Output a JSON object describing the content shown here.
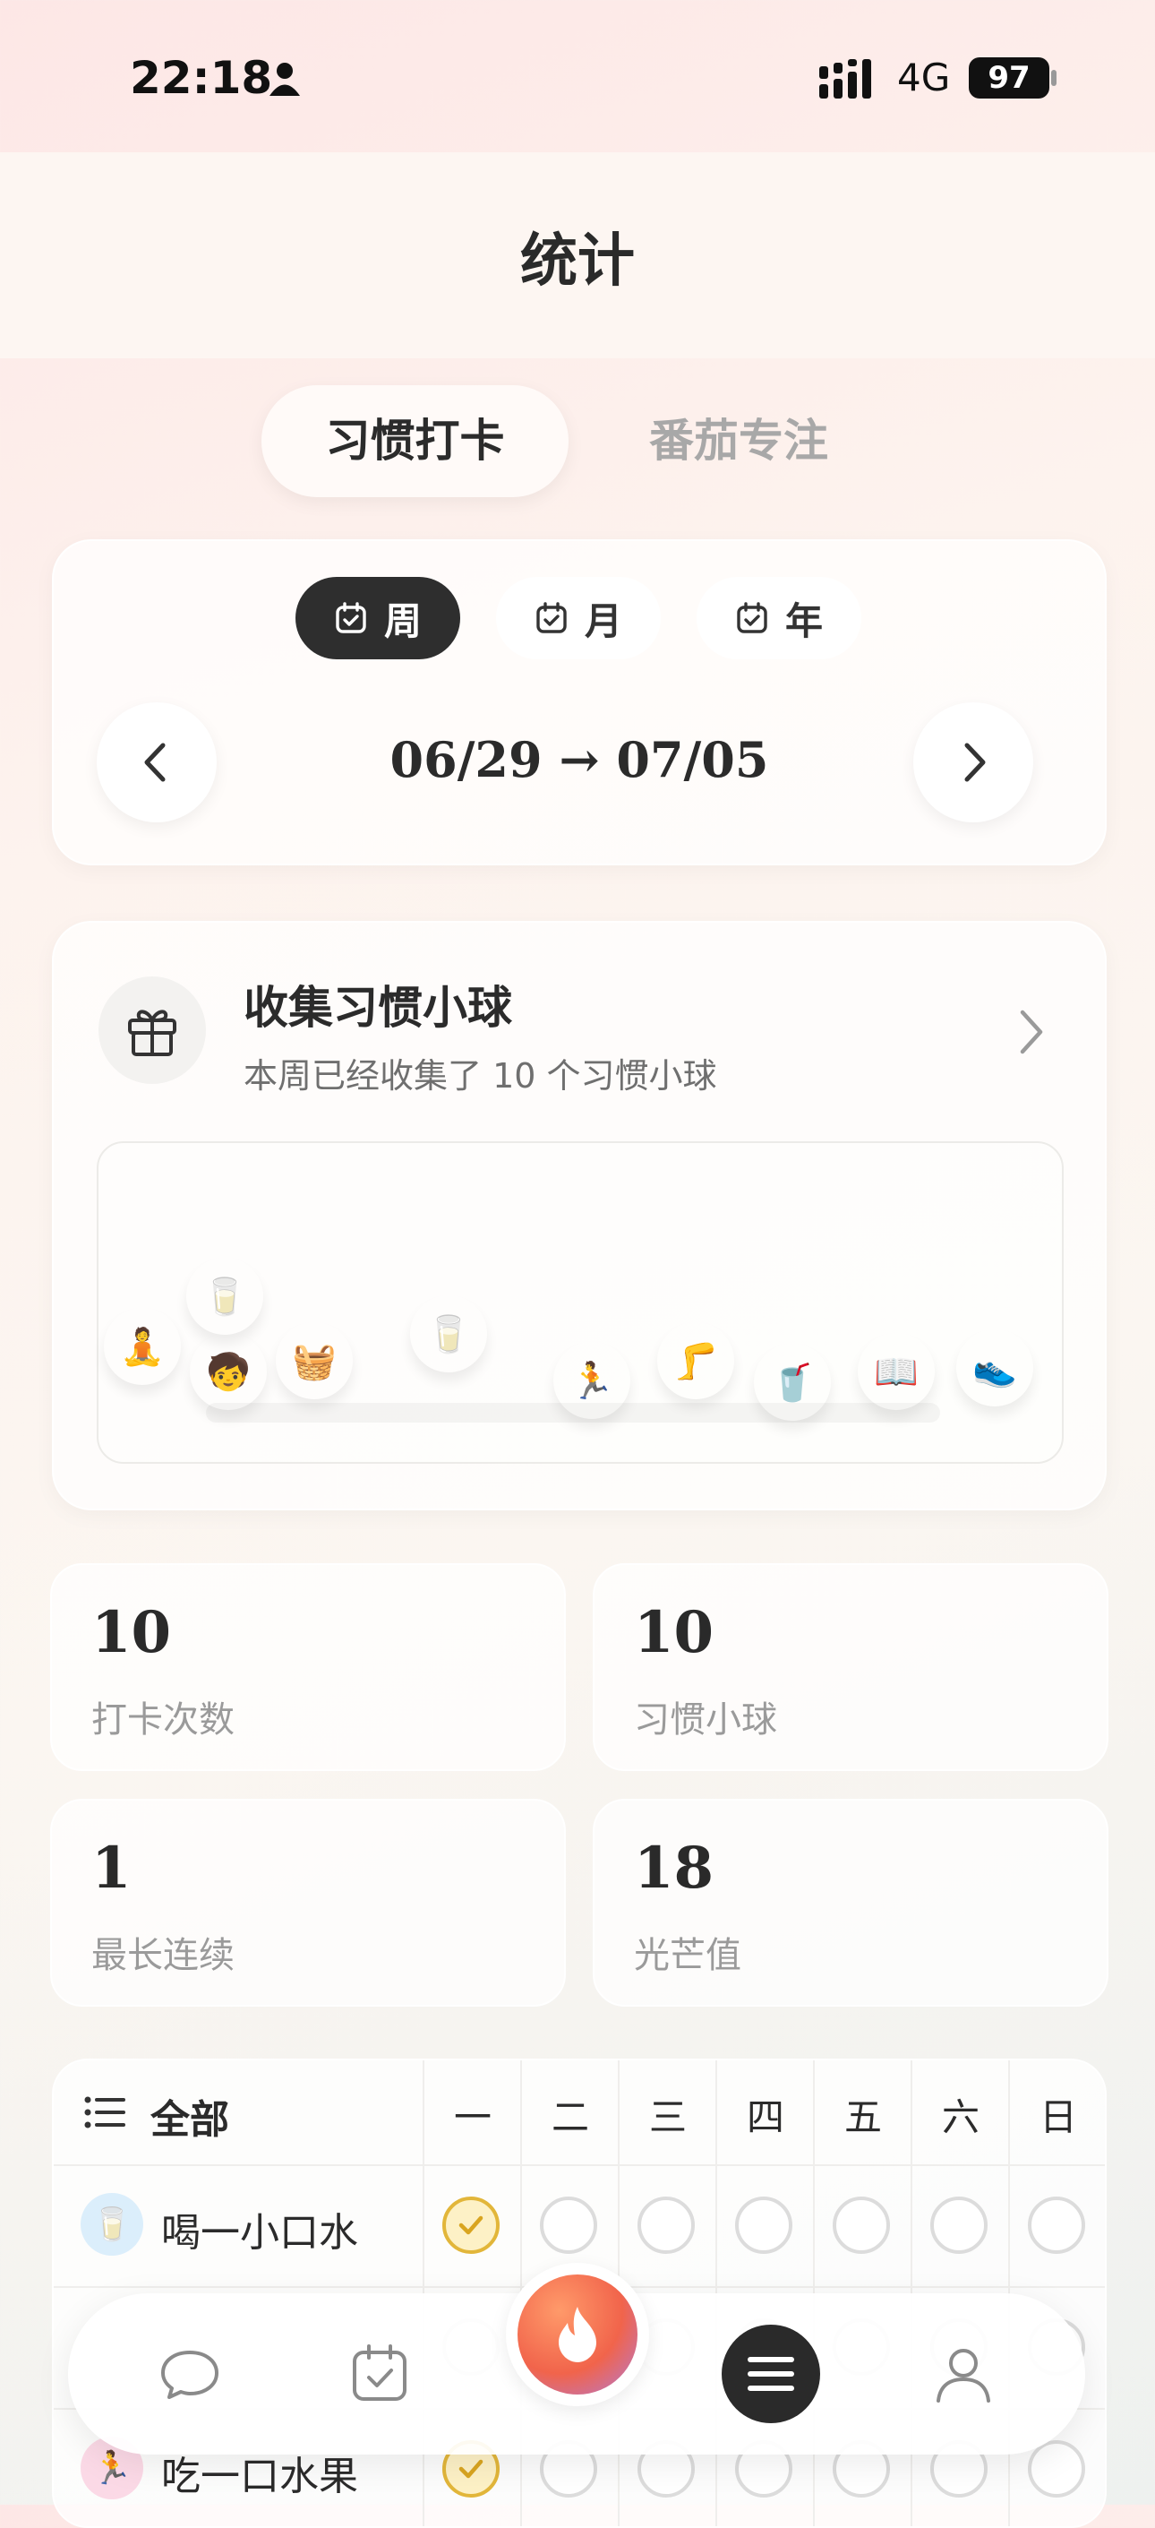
{
  "status_bar": {
    "time": "22:18",
    "network": "4G",
    "battery": "97"
  },
  "header": {
    "title": "统计"
  },
  "tabs": [
    {
      "label": "习惯打卡",
      "active": true
    },
    {
      "label": "番茄专注",
      "active": false
    }
  ],
  "period": {
    "options": [
      {
        "label": "周",
        "active": true
      },
      {
        "label": "月",
        "active": false
      },
      {
        "label": "年",
        "active": false
      }
    ],
    "range": "06/29 → 07/05"
  },
  "collect": {
    "title": "收集习惯小球",
    "subtitle": "本周已经收集了 10 个习惯小球",
    "balls": [
      {
        "icon": "boy-sitting-icon",
        "emoji": "🧘",
        "color": "#a9dcd8"
      },
      {
        "icon": "milk-glass-icon",
        "emoji": "🥛",
        "color": "#d6ecfb"
      },
      {
        "icon": "boy-icon",
        "emoji": "🧒",
        "color": "#a7dcc0"
      },
      {
        "icon": "fruit-basket-icon",
        "emoji": "🧺",
        "color": "#fbcfb0"
      },
      {
        "icon": "milk-glass-icon",
        "emoji": "🥛",
        "color": "#d6ecfb"
      },
      {
        "icon": "boy-running-icon",
        "emoji": "🏃",
        "color": "#fbd9e6"
      },
      {
        "icon": "leg-icon",
        "emoji": "🦵",
        "color": "#f8e7a4"
      },
      {
        "icon": "water-glass-icon",
        "emoji": "🥤",
        "color": "#d4cdf0"
      },
      {
        "icon": "book-icon",
        "emoji": "📖",
        "color": "#efe9dc"
      },
      {
        "icon": "shoe-icon",
        "emoji": "👟",
        "color": "#fbd8c6"
      }
    ]
  },
  "stats": [
    {
      "value": "10",
      "label": "打卡次数"
    },
    {
      "value": "10",
      "label": "习惯小球"
    },
    {
      "value": "1",
      "label": "最长连续"
    },
    {
      "value": "18",
      "label": "光芒值"
    }
  ],
  "habits": {
    "filter_label": "全部",
    "days": [
      "一",
      "二",
      "三",
      "四",
      "五",
      "六",
      "日"
    ],
    "rows": [
      {
        "name": "喝一小口水",
        "icon": "milk-glass-icon",
        "emoji": "🥛",
        "color": "#dbeefb",
        "checks": [
          true,
          false,
          false,
          false,
          false,
          false,
          false
        ]
      },
      {
        "name": "",
        "icon": "",
        "emoji": "",
        "color": "#ffffff",
        "checks": [
          false,
          false,
          false,
          false,
          false,
          false,
          false
        ]
      },
      {
        "name": "吃一口水果",
        "icon": "boy-running-icon",
        "emoji": "🏃",
        "color": "#fbd9e6",
        "checks": [
          true,
          false,
          false,
          false,
          false,
          false,
          false
        ]
      }
    ]
  },
  "nav": {
    "items": [
      "chat-icon",
      "calendar-check-icon",
      "fire-icon",
      "menu-icon",
      "profile-icon"
    ]
  }
}
